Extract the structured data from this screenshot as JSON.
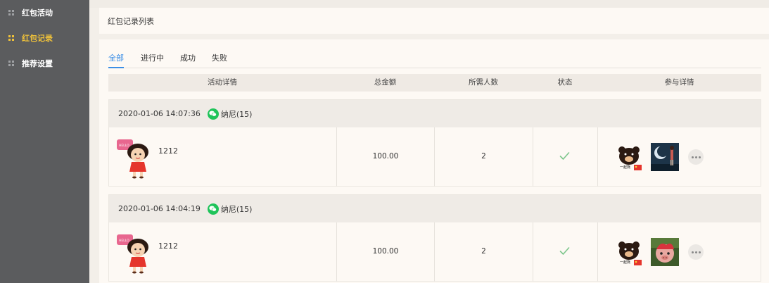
{
  "sidebar": {
    "items": [
      {
        "label": "红包活动",
        "icon": "grid-icon",
        "active": false
      },
      {
        "label": "红包记录",
        "icon": "grid-icon",
        "active": true
      },
      {
        "label": "推荐设置",
        "icon": "grid-icon",
        "active": false
      }
    ]
  },
  "header": {
    "title": "红包记录列表"
  },
  "tabs": [
    {
      "label": "全部",
      "active": true
    },
    {
      "label": "进行中",
      "active": false
    },
    {
      "label": "成功",
      "active": false
    },
    {
      "label": "失败",
      "active": false
    }
  ],
  "table": {
    "columns": [
      "活动详情",
      "总金额",
      "所需人数",
      "状态",
      "参与详情"
    ]
  },
  "records": [
    {
      "time": "2020-01-06 14:07:36",
      "user": "纳尼(15)",
      "activity_name": "1212",
      "amount": "100.00",
      "required": "2",
      "status": "success-check-icon"
    },
    {
      "time": "2020-01-06 14:04:19",
      "user": "纳尼(15)",
      "activity_name": "1212",
      "amount": "100.00",
      "required": "2",
      "status": "success-check-icon"
    }
  ],
  "colors": {
    "sidebar_bg": "#5b5c5e",
    "active_nav": "#f0c23a",
    "tab_active": "#3a8ee6",
    "wechat_green": "#1fc45a",
    "success_check": "#7cc68b"
  }
}
